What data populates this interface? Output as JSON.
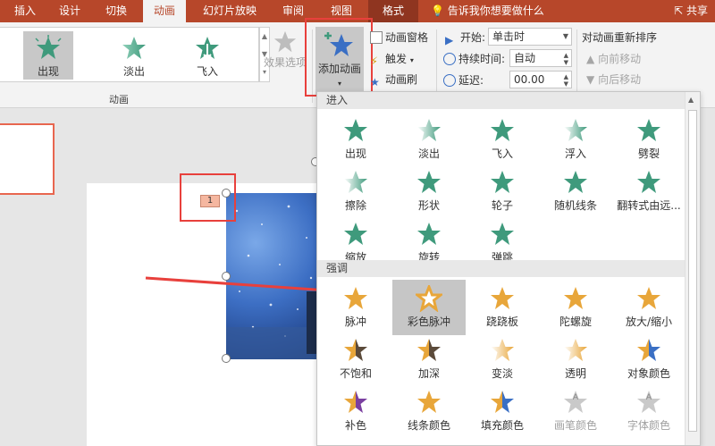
{
  "tabs": [
    "插入",
    "设计",
    "切换",
    "动画",
    "幻灯片放映",
    "审阅",
    "视图",
    "格式"
  ],
  "active_tab": "动画",
  "tell_me": "告诉我你想要做什么",
  "share": "共享",
  "gallery": {
    "items": [
      "出现",
      "淡出",
      "飞入"
    ],
    "selected": "出现",
    "effect_options": "效果选项",
    "group_label": "动画"
  },
  "add_animation": "添加动画",
  "advanced": {
    "pane": "动画窗格",
    "trigger": "触发",
    "painter": "动画刷"
  },
  "timing": {
    "start_label": "开始:",
    "start_value": "单击时",
    "duration_label": "持续时间:",
    "duration_value": "自动",
    "delay_label": "延迟:",
    "delay_value": "00.00"
  },
  "reorder": {
    "title": "对动画重新排序",
    "earlier": "向前移动",
    "later": "向后移动"
  },
  "slide": {
    "anim_badge": "1"
  },
  "panel": {
    "entrance_title": "进入",
    "entrance": [
      "出现",
      "淡出",
      "飞入",
      "浮入",
      "劈裂",
      "擦除",
      "形状",
      "轮子",
      "随机线条",
      "翻转式由远...",
      "缩放",
      "旋转",
      "弹跳"
    ],
    "emphasis_title": "强调",
    "emphasis": [
      "脉冲",
      "彩色脉冲",
      "跷跷板",
      "陀螺旋",
      "放大/缩小",
      "不饱和",
      "加深",
      "变淡",
      "透明",
      "对象颜色",
      "补色",
      "线条颜色",
      "填充颜色",
      "画笔颜色",
      "字体颜色"
    ],
    "selected": "彩色脉冲"
  },
  "colors": {
    "brand": "#b7472a",
    "entrance_star": "#3f9a7c",
    "emphasis_star": "#e8a63a",
    "highlight_red": "#e8403c"
  }
}
